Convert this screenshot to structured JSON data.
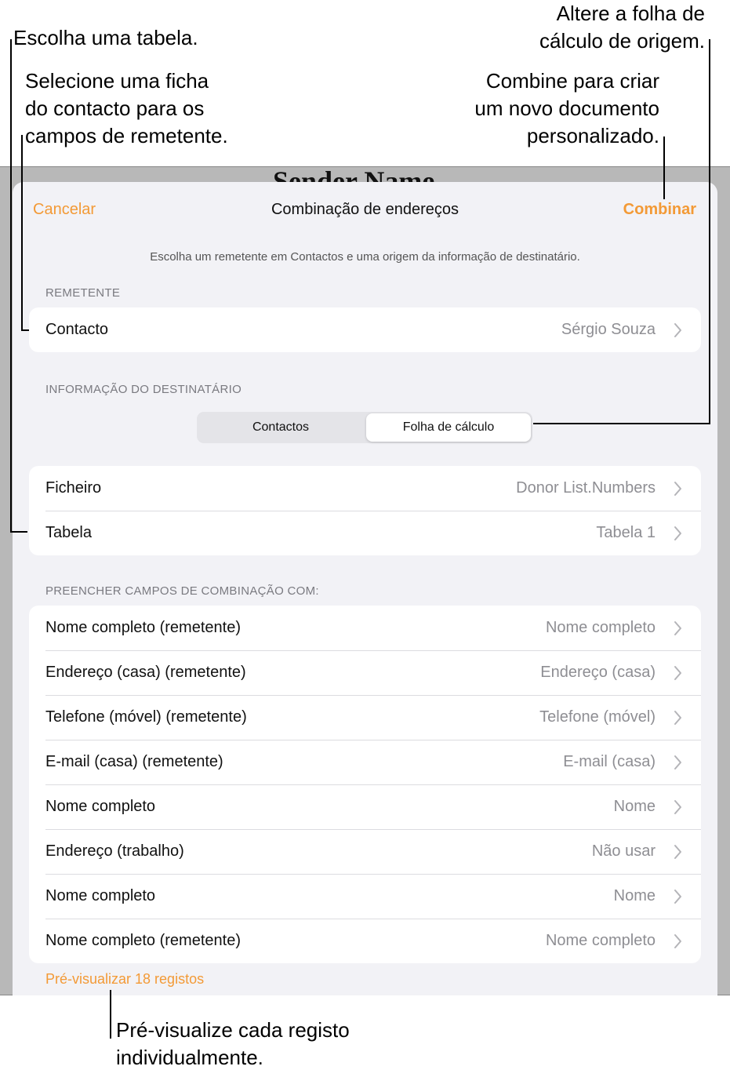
{
  "callouts": {
    "choose_table": "Escolha uma tabela.",
    "select_contact": "Selecione uma ficha\ndo contacto para os\ncampos de remetente.",
    "change_source": "Altere a folha de\ncálculo de origem.",
    "combine_doc": "Combine para criar\num novo documento\npersonalizado.",
    "preview_each": "Pré-visualize cada registo\nindividualmente."
  },
  "background": {
    "doc_title": "Sender Name"
  },
  "nav": {
    "cancel_label": "Cancelar",
    "title": "Combinação de endereços",
    "combine_label": "Combinar"
  },
  "subtitle": "Escolha um remetente em Contactos e uma origem da informação de destinatário.",
  "sender": {
    "header": "REMETENTE",
    "rows": [
      {
        "label": "Contacto",
        "value": "Sérgio Souza"
      }
    ]
  },
  "recipient": {
    "header": "INFORMAÇÃO DO DESTINATÁRIO",
    "segments": [
      "Contactos",
      "Folha de cálculo"
    ],
    "selected_segment": "Folha de cálculo",
    "rows": [
      {
        "label": "Ficheiro",
        "value": "Donor List.Numbers"
      },
      {
        "label": "Tabela",
        "value": "Tabela 1"
      }
    ]
  },
  "merge_fields": {
    "header": "PREENCHER CAMPOS DE COMBINAÇÃO COM:",
    "rows": [
      {
        "label": "Nome completo (remetente)",
        "value": "Nome completo"
      },
      {
        "label": "Endereço (casa) (remetente)",
        "value": "Endereço (casa)"
      },
      {
        "label": "Telefone (móvel) (remetente)",
        "value": "Telefone (móvel)"
      },
      {
        "label": "E-mail (casa) (remetente)",
        "value": "E-mail (casa)"
      },
      {
        "label": "Nome completo",
        "value": "Nome"
      },
      {
        "label": "Endereço (trabalho)",
        "value": "Não usar"
      },
      {
        "label": "Nome completo",
        "value": "Nome"
      },
      {
        "label": "Nome completo (remetente)",
        "value": "Nome completo"
      }
    ]
  },
  "preview_link": "Pré-visualizar 18 registos",
  "colors": {
    "accent": "#f39a36",
    "sheet_bg": "#f2f2f6",
    "secondary_text": "#8e8e93"
  }
}
